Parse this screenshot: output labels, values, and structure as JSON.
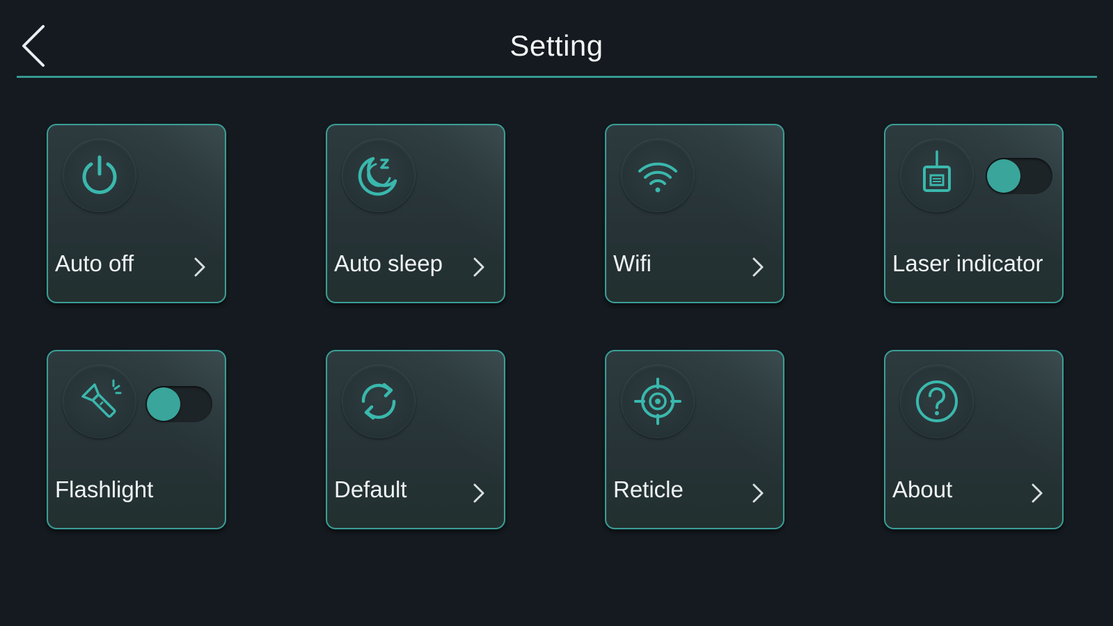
{
  "header": {
    "title": "Setting",
    "back_icon": "chevron-left-icon"
  },
  "accent_color": "#3aa79e",
  "tiles": [
    {
      "label": "Auto off",
      "icon": "power-icon",
      "has_chevron": true
    },
    {
      "label": "Auto sleep",
      "icon": "sleep-moon-icon",
      "has_chevron": true
    },
    {
      "label": "Wifi",
      "icon": "wifi-icon",
      "has_chevron": true
    },
    {
      "label": "Laser indicator",
      "icon": "laser-icon",
      "toggle_on": false
    },
    {
      "label": "Flashlight",
      "icon": "flashlight-icon",
      "toggle_on": false
    },
    {
      "label": "Default",
      "icon": "reset-icon",
      "has_chevron": true
    },
    {
      "label": "Reticle",
      "icon": "reticle-icon",
      "has_chevron": true
    },
    {
      "label": "About",
      "icon": "question-icon",
      "has_chevron": true
    }
  ]
}
